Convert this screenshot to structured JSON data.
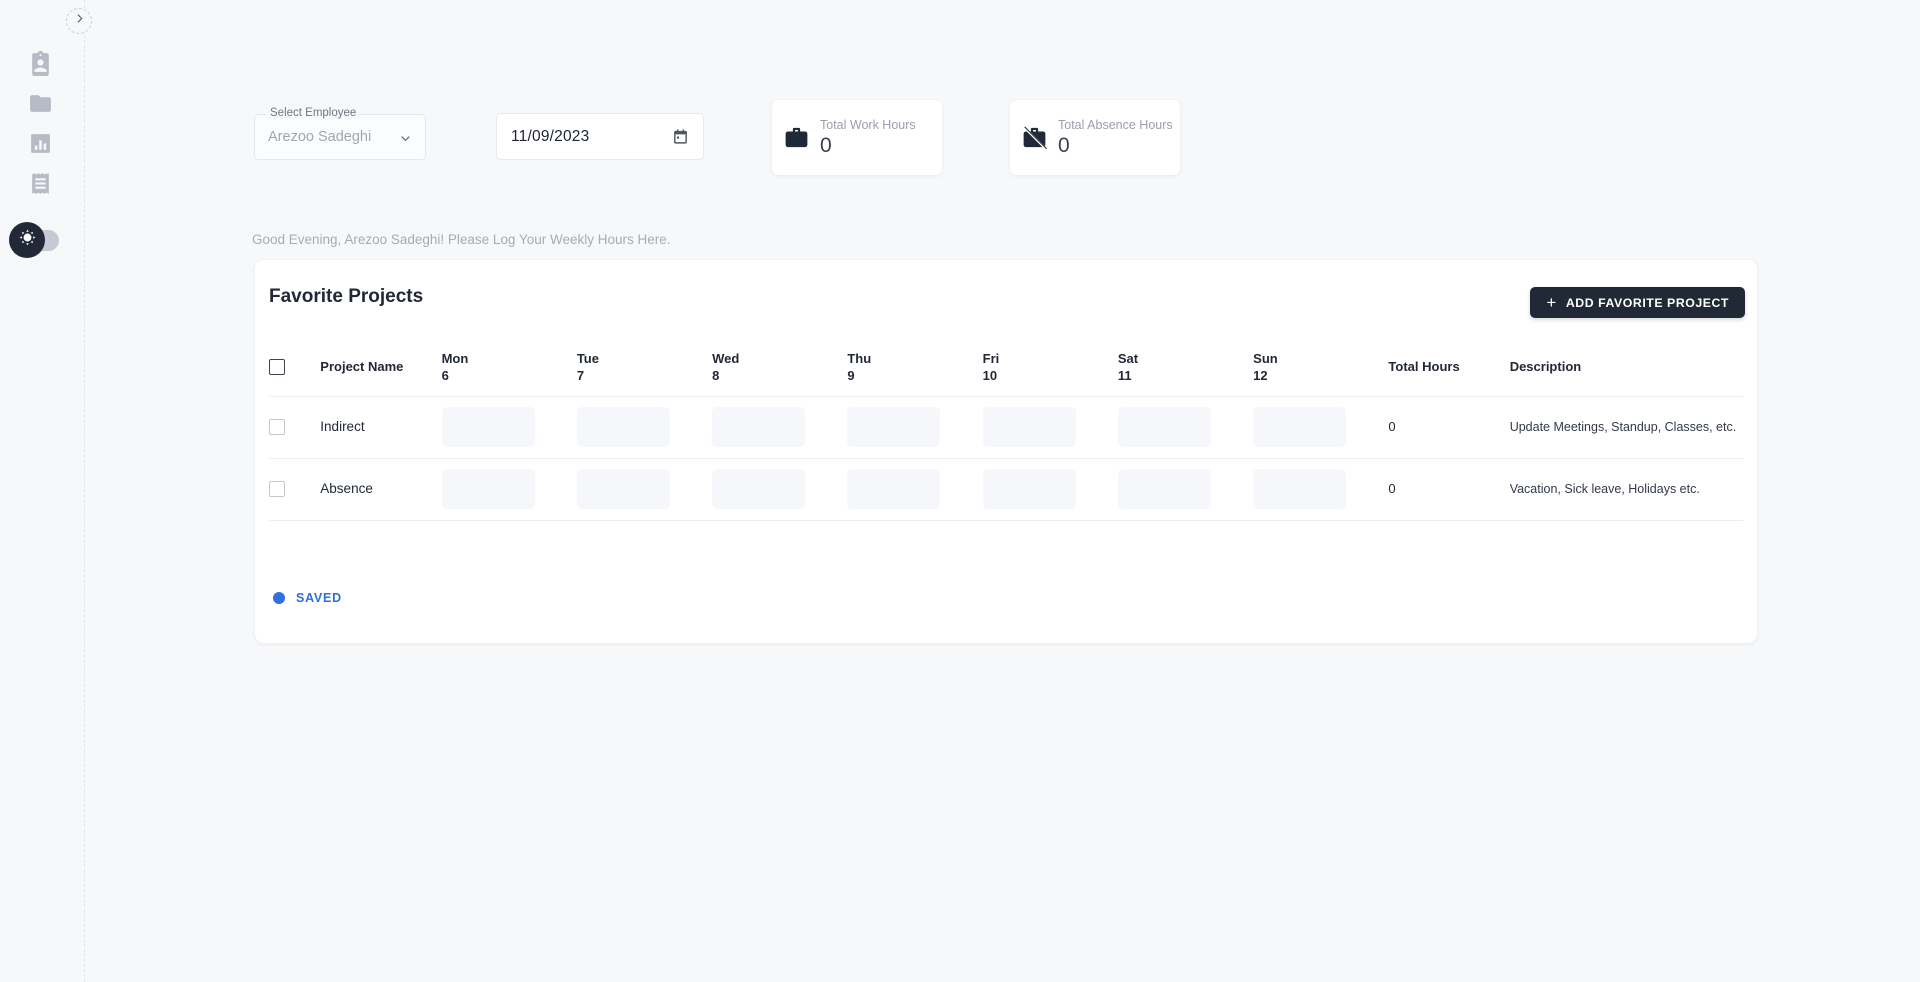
{
  "sidebar": {
    "collapse_button": {
      "icon": "chevron-right-icon"
    },
    "items": [
      {
        "name": "employee-badge",
        "icon": "badge-account-icon"
      },
      {
        "name": "projects-folder",
        "icon": "folder-icon"
      },
      {
        "name": "reports",
        "icon": "bar-chart-icon"
      },
      {
        "name": "invoices",
        "icon": "receipt-icon"
      }
    ],
    "theme_toggle": {
      "icon": "sun-icon",
      "state": "light"
    }
  },
  "controls": {
    "employee_select": {
      "label": "Select Employee",
      "value": "Arezoo Sadeghi",
      "icon": "chevron-down-icon"
    },
    "date_field": {
      "value": "11/09/2023",
      "placeholder": "mm/dd/yyyy",
      "icon": "calendar-icon"
    },
    "stats": [
      {
        "caption": "Total Work Hours",
        "value": "0",
        "icon": "briefcase-icon"
      },
      {
        "caption": "Total Absence Hours",
        "value": "0",
        "icon": "briefcase-off-icon"
      }
    ]
  },
  "greeting": "Good Evening, Arezoo Sadeghi! Please Log Your Weekly Hours Here.",
  "card": {
    "title": "Favorite Projects",
    "add_button": {
      "label": "ADD FAVORITE PROJECT",
      "icon": "plus-icon"
    }
  },
  "table": {
    "headers": {
      "project_name": "Project Name",
      "total_hours": "Total Hours",
      "description": "Description"
    },
    "days": [
      {
        "day": "Mon",
        "date": "6"
      },
      {
        "day": "Tue",
        "date": "7"
      },
      {
        "day": "Wed",
        "date": "8"
      },
      {
        "day": "Thu",
        "date": "9"
      },
      {
        "day": "Fri",
        "date": "10"
      },
      {
        "day": "Sat",
        "date": "11"
      },
      {
        "day": "Sun",
        "date": "12"
      }
    ],
    "rows": [
      {
        "name": "Indirect",
        "hours": [
          "",
          "",
          "",
          "",
          "",
          "",
          ""
        ],
        "total": "0",
        "description": "Update Meetings, Standup, Classes, etc."
      },
      {
        "name": "Absence",
        "hours": [
          "",
          "",
          "",
          "",
          "",
          "",
          ""
        ],
        "total": "0",
        "description": "Vacation, Sick leave, Holidays etc."
      }
    ]
  },
  "status": {
    "label": "SAVED",
    "color": "#2f6fe0"
  }
}
